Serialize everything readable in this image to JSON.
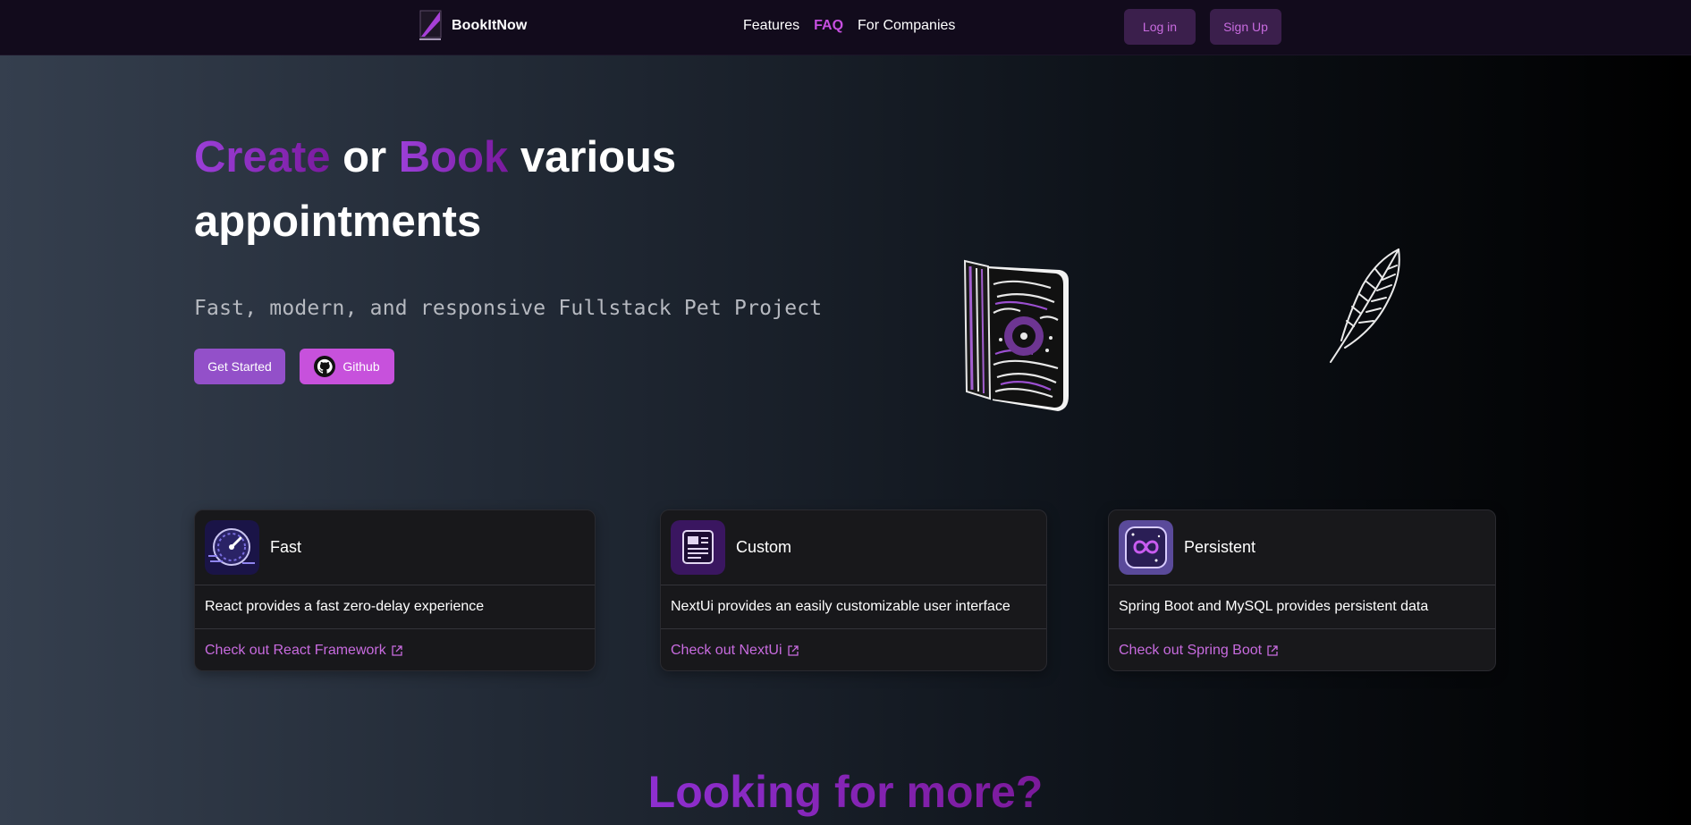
{
  "navbar": {
    "brand": "BookItNow",
    "links": [
      "Features",
      "FAQ",
      "For Companies"
    ],
    "active_link": "FAQ",
    "login_label": "Log in",
    "signup_label": "Sign Up"
  },
  "hero": {
    "title_word_create": "Create",
    "title_word_or": " or ",
    "title_word_book": "Book",
    "title_rest": " various appointments",
    "subtitle": "Fast, modern, and responsive Fullstack Pet Project",
    "get_started_label": "Get Started",
    "github_label": "Github",
    "illustrations": [
      "book-illustration",
      "feather-illustration"
    ]
  },
  "cards": [
    {
      "title": "Fast",
      "icon": "speedometer-icon",
      "description": "React provides a fast zero-delay experience",
      "link": "Check out React Framework"
    },
    {
      "title": "Custom",
      "icon": "ui-layout-icon",
      "description": "NextUi provides an easily customizable user interface",
      "link": "Check out NextUi"
    },
    {
      "title": "Persistent",
      "icon": "infinity-icon",
      "description": "Spring Boot and MySQL provides persistent data",
      "link": "Check out Spring Boot"
    }
  ],
  "more": {
    "title": "Looking for more?"
  },
  "colors": {
    "accent_purple": "#9350c9",
    "accent_pink": "#c751dc",
    "link_color": "#c86bdf",
    "navbar_bg": "#120b1c",
    "card_bg": "#18181b"
  }
}
